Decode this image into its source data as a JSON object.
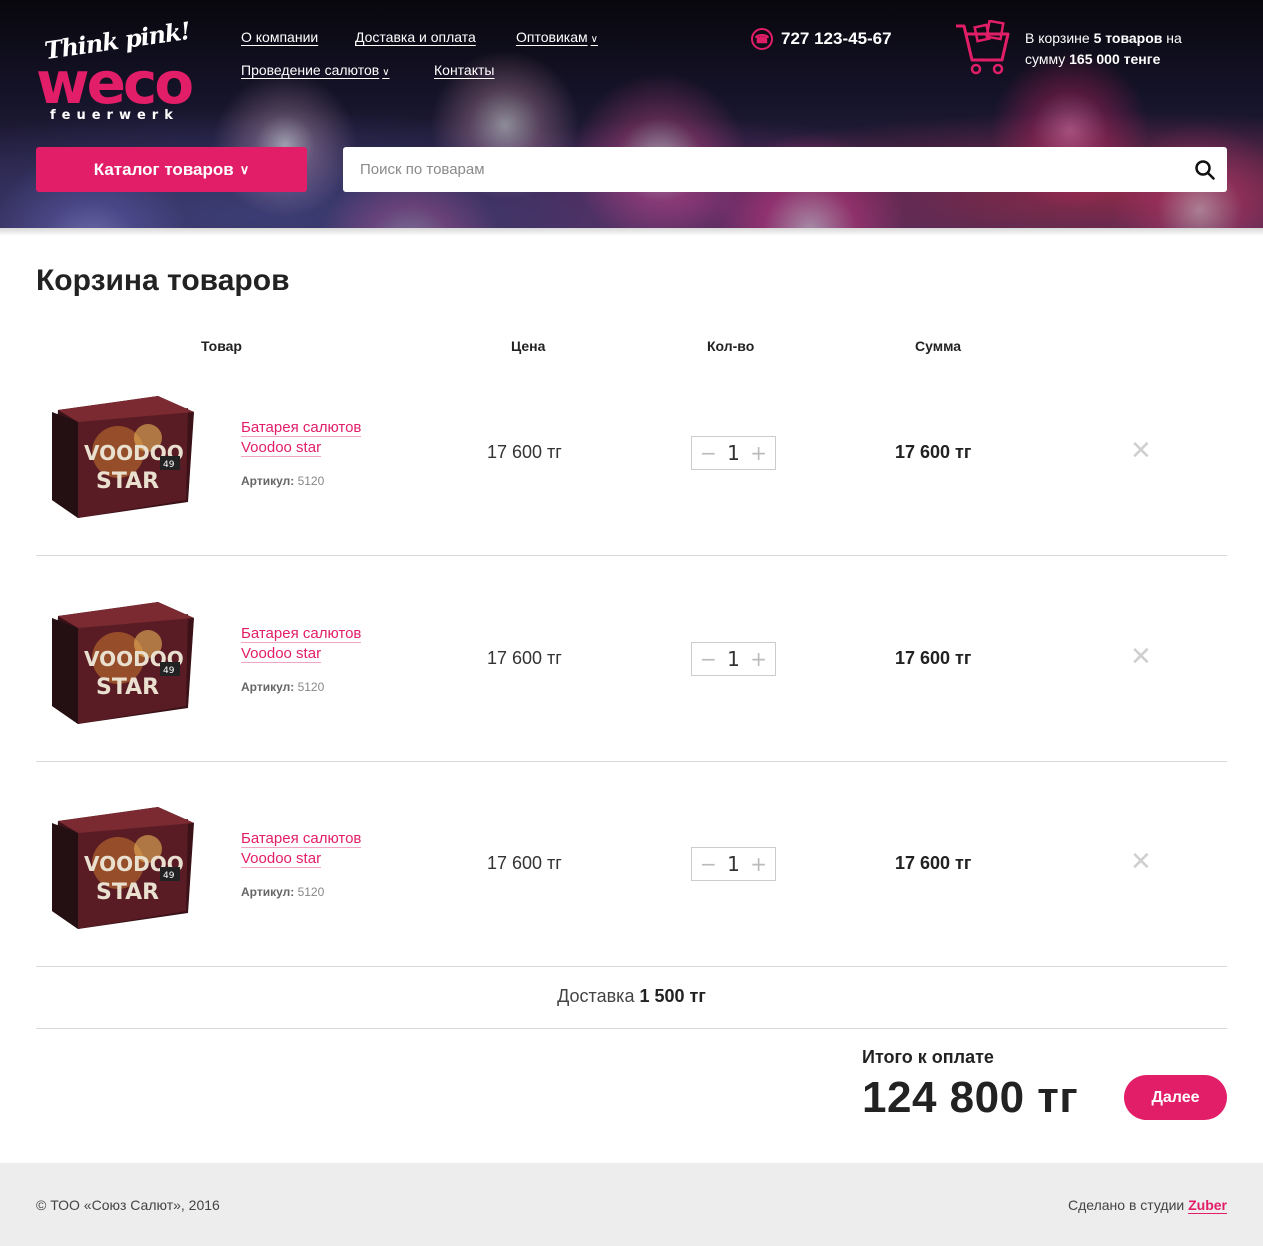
{
  "colors": {
    "accent": "#e21e68",
    "footer_bg": "#ededed",
    "divider": "#d9d9d9"
  },
  "logo": {
    "tagline": "Think pink!",
    "brand": "weco",
    "subbrand": "feuerwerk"
  },
  "nav": {
    "items": [
      {
        "label": "О компании",
        "has_dropdown": false
      },
      {
        "label": "Доставка и оплата",
        "has_dropdown": false
      },
      {
        "label": "Оптовикам",
        "has_dropdown": true
      },
      {
        "label": "Проведение салютов",
        "has_dropdown": true
      },
      {
        "label": "Контакты",
        "has_dropdown": false
      }
    ]
  },
  "phone": {
    "number": "727 123-45-67",
    "icon": "phone-icon"
  },
  "cart_summary": {
    "prefix": "В корзине",
    "count": "5 товаров",
    "middle": "на сумму",
    "amount": "165 000 тенге",
    "icon": "cart-icon"
  },
  "catalog_button": {
    "label": "Каталог товаров"
  },
  "search": {
    "placeholder": "Поиск по товарам",
    "value": "",
    "icon": "search-icon"
  },
  "cart": {
    "title": "Корзина товаров",
    "headers": {
      "product": "Товар",
      "price": "Цена",
      "qty": "Кол-во",
      "sum": "Сумма"
    },
    "items": [
      {
        "name_line1": "Батарея салютов",
        "name_line2": "Voodoo star",
        "sku_label": "Артикул:",
        "sku": "5120",
        "price": "17 600 тг",
        "qty": "1",
        "sum": "17 600 тг"
      },
      {
        "name_line1": "Батарея салютов",
        "name_line2": "Voodoo star",
        "sku_label": "Артикул:",
        "sku": "5120",
        "price": "17 600 тг",
        "qty": "1",
        "sum": "17 600 тг"
      },
      {
        "name_line1": "Батарея салютов",
        "name_line2": "Voodoo star",
        "sku_label": "Артикул:",
        "sku": "5120",
        "price": "17 600 тг",
        "qty": "1",
        "sum": "17 600 тг"
      }
    ],
    "delivery_label": "Доставка",
    "delivery_value": "1 500 тг",
    "total_label": "Итого к оплате",
    "total_value": "124 800 тг",
    "next_button": "Далее"
  },
  "footer": {
    "copyright": "© ТОО «Союз Салют», 2016",
    "studio_prefix": "Сделано в студии",
    "studio_name": "Zuber"
  }
}
